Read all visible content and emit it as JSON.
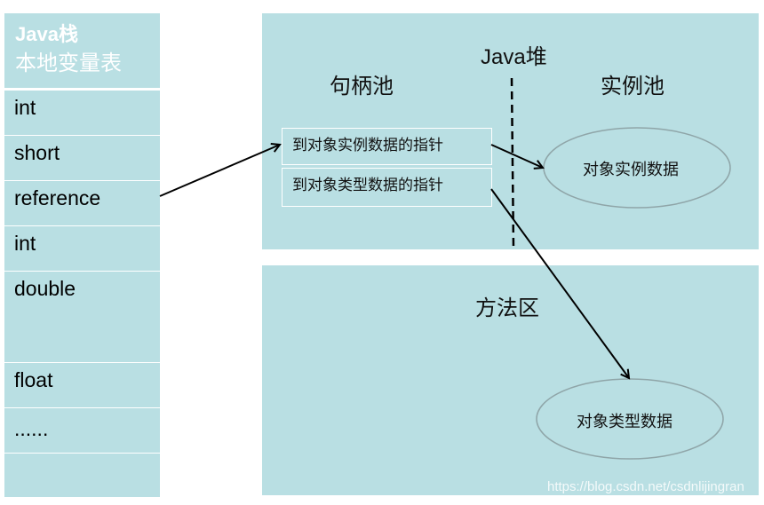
{
  "stack": {
    "title": "Java栈",
    "subtitle": "本地变量表",
    "rows": [
      {
        "label": "int"
      },
      {
        "label": "short"
      },
      {
        "label": "reference"
      },
      {
        "label": "int"
      },
      {
        "label": "double"
      },
      {
        "label": "float"
      },
      {
        "label": "......"
      },
      {
        "label": ""
      }
    ]
  },
  "heap": {
    "title": "Java堆",
    "handle_pool": {
      "title": "句柄池",
      "pointers": [
        {
          "label": "到对象实例数据的指针"
        },
        {
          "label": "到对象类型数据的指针"
        }
      ]
    },
    "instance_pool": {
      "title": "实例池",
      "node": "对象实例数据"
    }
  },
  "method_area": {
    "title": "方法区",
    "node": "对象类型数据"
  },
  "colors": {
    "box_fill": "#b9dfe3",
    "text_white": "#ffffff",
    "line": "#000000",
    "ellipse_stroke": "#8fa5a8"
  },
  "watermark": "https://blog.csdn.net/csdnlijingran"
}
